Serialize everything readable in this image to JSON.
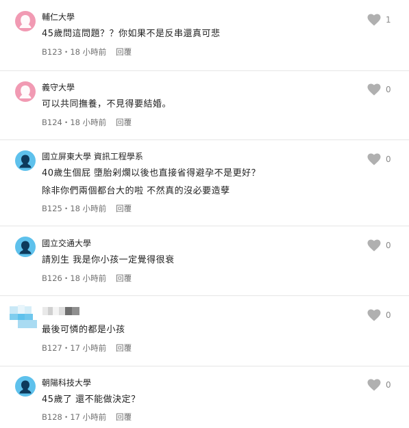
{
  "comments": [
    {
      "school": "輔仁大學",
      "lines": [
        "45歲問這問題？？你如果不是反串還真可悲"
      ],
      "floor": "B123",
      "time": "18 小時前",
      "reply": "回覆",
      "likes": "1",
      "avatar": "female-avatar-icon",
      "avatar_color": "#f19ab3"
    },
    {
      "school": "義守大學",
      "lines": [
        "可以共同撫養，不見得要結婚。"
      ],
      "floor": "B124",
      "time": "18 小時前",
      "reply": "回覆",
      "likes": "0",
      "avatar": "female-avatar-icon",
      "avatar_color": "#f19ab3"
    },
    {
      "school": "國立屏東大學 資訊工程學系",
      "lines": [
        "40歲生個屁 墮胎剁爛以後也直接省得避孕不是更好？",
        "除非你們兩個都台大的啦 不然真的沒必要造孽"
      ],
      "floor": "B125",
      "time": "18 小時前",
      "reply": "回覆",
      "likes": "0",
      "avatar": "male-avatar-icon",
      "avatar_color": "#5ec1ec"
    },
    {
      "school": "國立交通大學",
      "lines": [
        "請別生 我是你小孩一定覺得很衰"
      ],
      "floor": "B126",
      "time": "18 小時前",
      "reply": "回覆",
      "likes": "0",
      "avatar": "male-avatar-icon",
      "avatar_color": "#5ec1ec"
    },
    {
      "school": "",
      "lines": [
        "最後可憐的都是小孩"
      ],
      "floor": "B127",
      "time": "17 小時前",
      "reply": "回覆",
      "likes": "0",
      "avatar": "pixelated-avatar-icon",
      "avatar_color": "#5ec1ec"
    },
    {
      "school": "朝陽科技大學",
      "lines": [
        "45歲了 還不能做決定？"
      ],
      "floor": "B128",
      "time": "17 小時前",
      "reply": "回覆",
      "likes": "0",
      "avatar": "male-avatar-icon",
      "avatar_color": "#5ec1ec"
    }
  ],
  "meta_separator": "・",
  "like_icon": "heart-icon",
  "colors": {
    "like": "#b0b0b0",
    "divider": "#e5e5e5",
    "meta": "#6f6f6f"
  }
}
